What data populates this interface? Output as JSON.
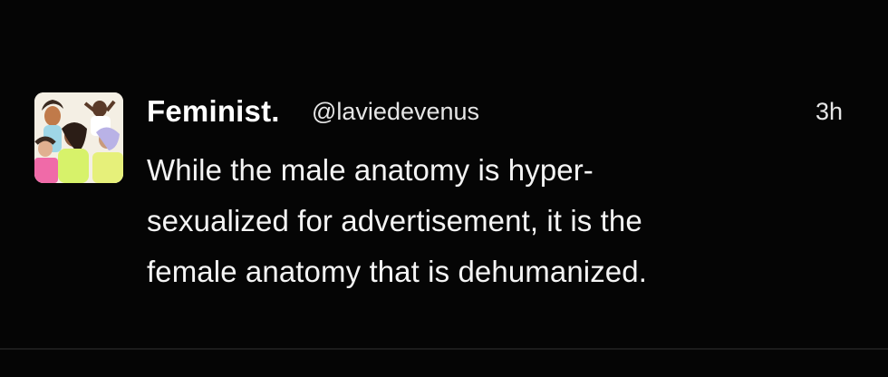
{
  "tweet": {
    "author": {
      "display_name": "Feminist.",
      "handle": "@laviedevenus",
      "avatar_icon": "illustrated-women-avatar"
    },
    "time": "3h",
    "text_lines": [
      "While the male anatomy is hyper-",
      "sexualized for advertisement, it is the",
      "female anatomy that is dehumanized."
    ]
  },
  "colors": {
    "background": "#050505",
    "text": "#f4f4f4"
  }
}
